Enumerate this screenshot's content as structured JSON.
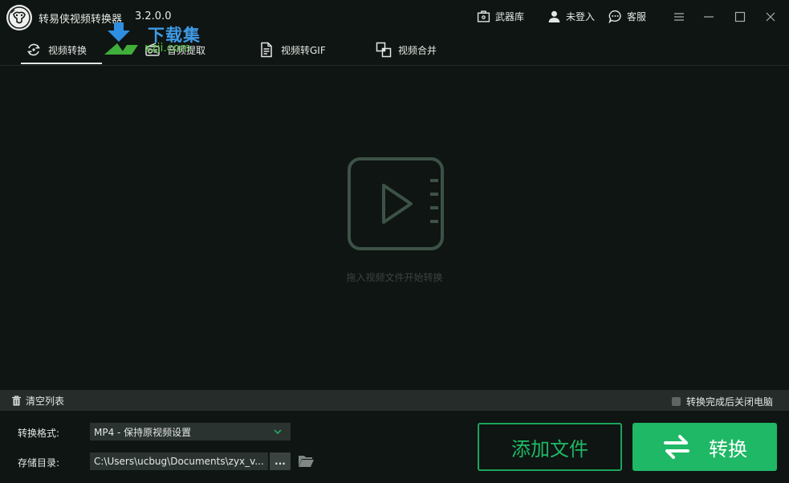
{
  "window": {
    "title": "转易侠视频转换器",
    "version": "3.2.0.0"
  },
  "titlebar": {
    "armory_label": "武器库",
    "login_label": "未登入",
    "service_label": "客服"
  },
  "watermark": {
    "text": "下载集",
    "sub": "xzji.com"
  },
  "tabs": [
    {
      "label": "视频转换",
      "active": true,
      "icon": "refresh-circle-icon"
    },
    {
      "label": "音频提取",
      "active": false,
      "icon": "radio-icon"
    },
    {
      "label": "视频转GIF",
      "active": false,
      "icon": "document-icon"
    },
    {
      "label": "视频合并",
      "active": false,
      "icon": "merge-icon"
    }
  ],
  "dropzone": {
    "hint": "拖入视频文件开始转换",
    "icon": "video-play-icon"
  },
  "listbar": {
    "clear_label": "清空列表",
    "shutdown_label": "转换完成后关闭电脑",
    "shutdown_checked": false
  },
  "settings": {
    "format_label": "转换格式:",
    "format_value": "MP4 - 保持原视频设置",
    "dir_label": "存储目录:",
    "dir_value": "C:\\Users\\ucbug\\Documents\\zyx_v...",
    "browse_label": "..."
  },
  "actions": {
    "add_label": "添加文件",
    "convert_label": "转换"
  },
  "colors": {
    "accent": "#1fb866",
    "background": "#0f1512",
    "bar": "#252c29"
  }
}
